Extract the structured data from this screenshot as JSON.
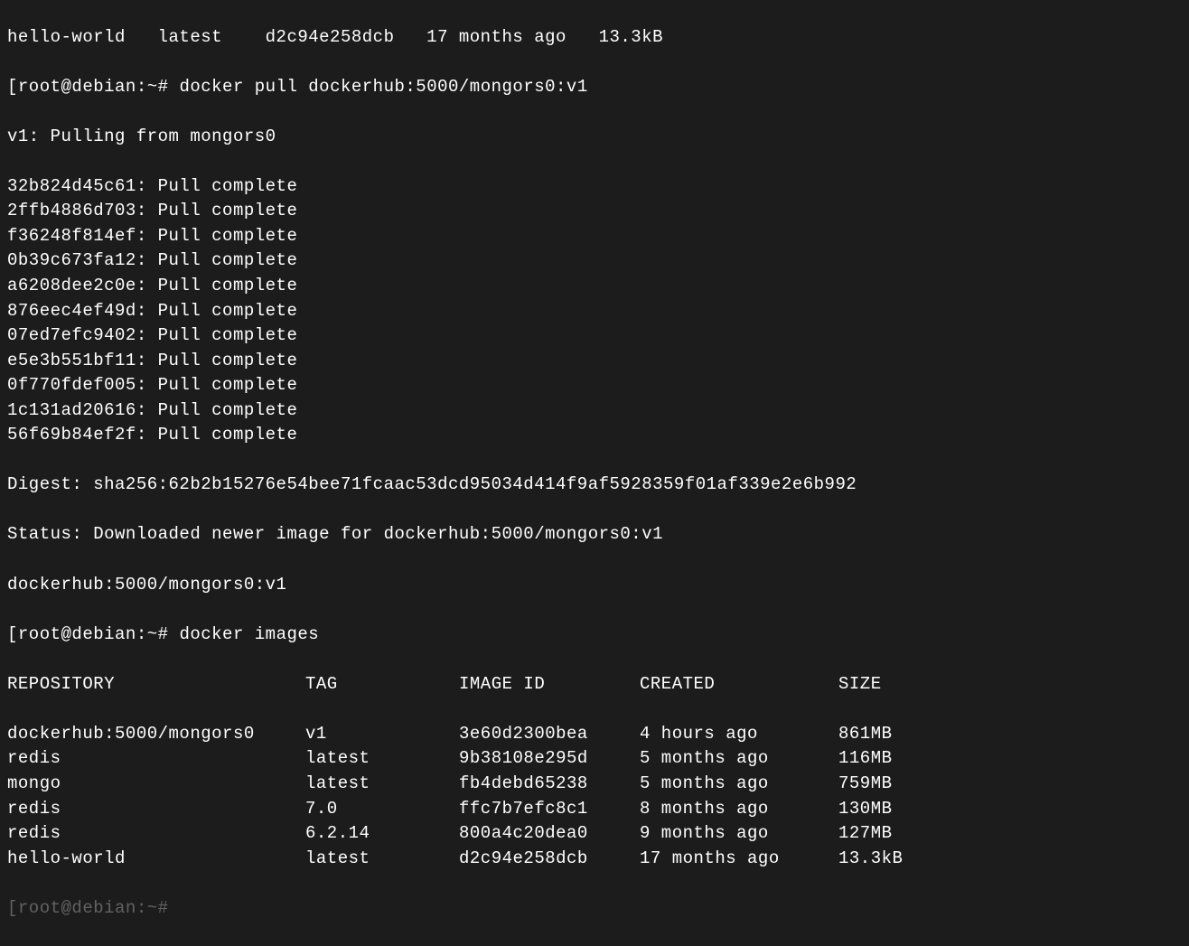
{
  "partial_top_line": "hello-world   latest    d2c94e258dcb   17 months ago   13.3kB",
  "prompt1": {
    "bracket_open": "[",
    "user_host": "root@debian",
    "separator": ":",
    "path": "~",
    "hash": "#",
    "command": "docker pull dockerhub:5000/mongors0:v1"
  },
  "pull_header": "v1: Pulling from mongors0",
  "pull_layers": [
    {
      "hash": "32b824d45c61",
      "status": "Pull complete"
    },
    {
      "hash": "2ffb4886d703",
      "status": "Pull complete"
    },
    {
      "hash": "f36248f814ef",
      "status": "Pull complete"
    },
    {
      "hash": "0b39c673fa12",
      "status": "Pull complete"
    },
    {
      "hash": "a6208dee2c0e",
      "status": "Pull complete"
    },
    {
      "hash": "876eec4ef49d",
      "status": "Pull complete"
    },
    {
      "hash": "07ed7efc9402",
      "status": "Pull complete"
    },
    {
      "hash": "e5e3b551bf11",
      "status": "Pull complete"
    },
    {
      "hash": "0f770fdef005",
      "status": "Pull complete"
    },
    {
      "hash": "1c131ad20616",
      "status": "Pull complete"
    },
    {
      "hash": "56f69b84ef2f",
      "status": "Pull complete"
    }
  ],
  "digest_line": "Digest: sha256:62b2b15276e54bee71fcaac53dcd95034d414f9af5928359f01af339e2e6b992",
  "status_line": "Status: Downloaded newer image for dockerhub:5000/mongors0:v1",
  "image_ref_line": "dockerhub:5000/mongors0:v1",
  "prompt2": {
    "bracket_open": "[",
    "user_host": "root@debian",
    "separator": ":",
    "path": "~",
    "hash": "#",
    "command": "docker images"
  },
  "table_headers": {
    "repo": "REPOSITORY",
    "tag": "TAG",
    "image_id": "IMAGE ID",
    "created": "CREATED",
    "size": "SIZE"
  },
  "images_table": [
    {
      "repo": "dockerhub:5000/mongors0",
      "tag": "v1",
      "image_id": "3e60d2300bea",
      "created": "4 hours ago",
      "size": "861MB"
    },
    {
      "repo": "redis",
      "tag": "latest",
      "image_id": "9b38108e295d",
      "created": "5 months ago",
      "size": "116MB"
    },
    {
      "repo": "mongo",
      "tag": "latest",
      "image_id": "fb4debd65238",
      "created": "5 months ago",
      "size": "759MB"
    },
    {
      "repo": "redis",
      "tag": "7.0",
      "image_id": "ffc7b7efc8c1",
      "created": "8 months ago",
      "size": "130MB"
    },
    {
      "repo": "redis",
      "tag": "6.2.14",
      "image_id": "800a4c20dea0",
      "created": "9 months ago",
      "size": "127MB"
    },
    {
      "repo": "hello-world",
      "tag": "latest",
      "image_id": "d2c94e258dcb",
      "created": "17 months ago",
      "size": "13.3kB"
    }
  ],
  "prompt3_partial": {
    "bracket_open": "[",
    "rest": "root@debian:~#"
  }
}
